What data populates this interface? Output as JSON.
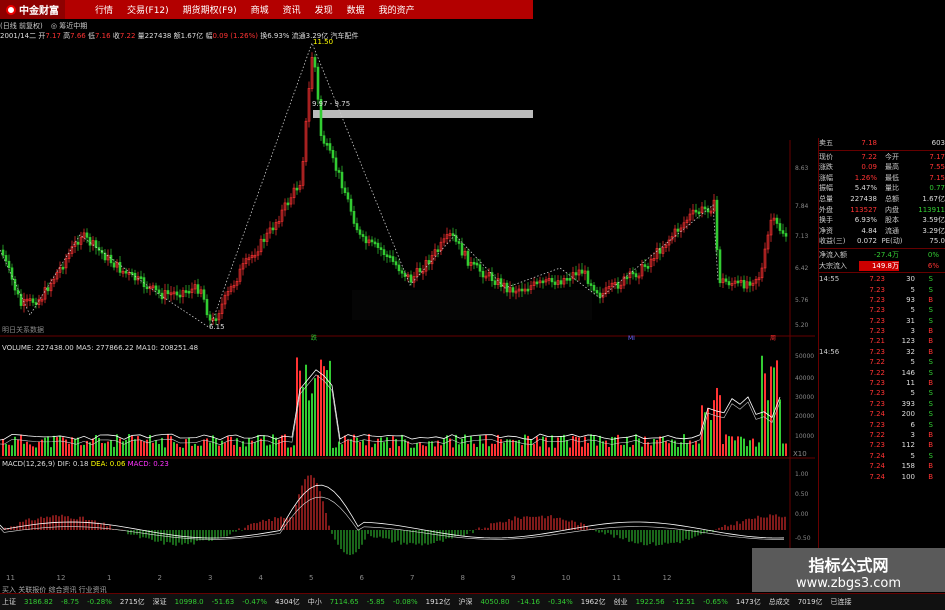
{
  "app": {
    "brand": "中金财富",
    "menu": [
      "行情",
      "交易(F12)",
      "期货期权(F9)",
      "商城",
      "资讯",
      "发现",
      "数据",
      "我的资产"
    ]
  },
  "info": {
    "stock": "2001/14二",
    "tabs": "(日线 前复权)",
    "buttons": "◎ 筹近中期"
  },
  "quote": {
    "open_label": "开",
    "open": "7.17",
    "high_label": "高",
    "high": "7.66",
    "low_label": "低",
    "low": "7.16",
    "close_label": "收",
    "close": "7.22",
    "vol_label": "量",
    "vol": "227438",
    "amt_label": "额",
    "amt": "1.67亿",
    "chg_label": "幅",
    "chg": "0.09 (1.26%)",
    "turn_label": "换",
    "turn": "6.93%",
    "float_label": "流通",
    "float": "3.29亿",
    "sector": "汽车配件"
  },
  "price_chart": {
    "high_label": "11.50",
    "low_label": "6.15",
    "band_label": "9.97 - 9.75",
    "axis_ticks": [
      "8.63",
      "7.84",
      "7.13",
      "6.42",
      "5.76",
      "5.20"
    ],
    "markers": [
      "跌",
      "MI",
      "周"
    ],
    "footnote": "明日关系数据"
  },
  "volume": {
    "header": "VOLUME: 227438.00  MA5: 277866.22  MA10: 208251.48",
    "axis_ticks": [
      "50000",
      "40000",
      "30000",
      "20000",
      "10000"
    ],
    "unit": "X10"
  },
  "macd": {
    "name": "MACD(12,26,9)",
    "dif": "DIF: 0.18",
    "dea": "DEA: 0.06",
    "macd": "MACD: 0.23",
    "axis_ticks": [
      "1.00",
      "0.50",
      "0.00",
      "-0.50"
    ]
  },
  "x_labels": [
    "11",
    "12",
    "1",
    "2",
    "3",
    "4",
    "5",
    "6",
    "7",
    "8",
    "9",
    "10",
    "11",
    "12"
  ],
  "right_panel": {
    "sell5": {
      "label": "卖五",
      "price": "7.18",
      "vol": "603"
    },
    "stats": [
      {
        "l1": "现价",
        "v1": "7.22",
        "l2": "今开",
        "v2": "7.17",
        "c1": "up",
        "c2": "up"
      },
      {
        "l1": "涨跌",
        "v1": "0.09",
        "l2": "最高",
        "v2": "7.55",
        "c1": "up",
        "c2": "up"
      },
      {
        "l1": "涨幅",
        "v1": "1.26%",
        "l2": "最低",
        "v2": "7.15",
        "c1": "up",
        "c2": "up"
      },
      {
        "l1": "振幅",
        "v1": "5.47%",
        "l2": "量比",
        "v2": "0.77",
        "c1": "wht",
        "c2": "down"
      },
      {
        "l1": "总量",
        "v1": "227438",
        "l2": "总额",
        "v2": "1.67亿",
        "c1": "wht",
        "c2": "wht"
      },
      {
        "l1": "外盘",
        "v1": "113527",
        "l2": "内盘",
        "v2": "113911",
        "c1": "up",
        "c2": "down"
      },
      {
        "l1": "换手",
        "v1": "6.93%",
        "l2": "股本",
        "v2": "3.59亿",
        "c1": "wht",
        "c2": "wht"
      },
      {
        "l1": "净资",
        "v1": "4.84",
        "l2": "流通",
        "v2": "3.29亿",
        "c1": "wht",
        "c2": "wht"
      },
      {
        "l1": "收益(三)",
        "v1": "0.072",
        "l2": "PE(动)",
        "v2": "75.0",
        "c1": "wht",
        "c2": "wht"
      }
    ],
    "flow": [
      {
        "label": "净流入额",
        "value": "-27.4万",
        "pct": "0%"
      },
      {
        "label": "大宗流入",
        "value": "149.8万",
        "pct": "6%"
      }
    ],
    "ticks_a": {
      "time": "14:55",
      "rows": [
        {
          "p": "7.23",
          "q": "30",
          "s": "S"
        },
        {
          "p": "7.23",
          "q": "5",
          "s": "S"
        },
        {
          "p": "7.23",
          "q": "93",
          "s": "B"
        },
        {
          "p": "7.23",
          "q": "5",
          "s": "S"
        },
        {
          "p": "7.23",
          "q": "31",
          "s": "S"
        },
        {
          "p": "7.23",
          "q": "3",
          "s": "B"
        },
        {
          "p": "7.21",
          "q": "123",
          "s": "B"
        }
      ]
    },
    "ticks_b": {
      "time": "14:56",
      "rows": [
        {
          "p": "7.23",
          "q": "32",
          "s": "B"
        },
        {
          "p": "7.22",
          "q": "5",
          "s": "S"
        },
        {
          "p": "7.22",
          "q": "146",
          "s": "S"
        },
        {
          "p": "7.23",
          "q": "11",
          "s": "B"
        },
        {
          "p": "7.23",
          "q": "5",
          "s": "S"
        },
        {
          "p": "7.23",
          "q": "393",
          "s": "S"
        },
        {
          "p": "7.24",
          "q": "200",
          "s": "S"
        },
        {
          "p": "7.23",
          "q": "6",
          "s": "S"
        },
        {
          "p": "7.22",
          "q": "3",
          "s": "B"
        },
        {
          "p": "7.23",
          "q": "112",
          "s": "B"
        },
        {
          "p": "7.24",
          "q": "5",
          "s": "S"
        },
        {
          "p": "7.24",
          "q": "158",
          "s": "B"
        },
        {
          "p": "7.24",
          "q": "100",
          "s": "B"
        }
      ]
    }
  },
  "status": {
    "items": [
      {
        "text": "上证",
        "c": "wht"
      },
      {
        "text": "3186.82",
        "c": "down"
      },
      {
        "text": "-8.75",
        "c": "down"
      },
      {
        "text": "-0.28%",
        "c": "down"
      },
      {
        "text": "2715亿",
        "c": "wht"
      },
      {
        "text": "深证",
        "c": "wht"
      },
      {
        "text": "10998.0",
        "c": "down"
      },
      {
        "text": "-51.63",
        "c": "down"
      },
      {
        "text": "-0.47%",
        "c": "down"
      },
      {
        "text": "4304亿",
        "c": "wht"
      },
      {
        "text": "中小",
        "c": "wht"
      },
      {
        "text": "7114.65",
        "c": "down"
      },
      {
        "text": "-5.85",
        "c": "down"
      },
      {
        "text": "-0.08%",
        "c": "down"
      },
      {
        "text": "1912亿",
        "c": "wht"
      },
      {
        "text": "沪深",
        "c": "wht"
      },
      {
        "text": "4050.80",
        "c": "down"
      },
      {
        "text": "-14.16",
        "c": "down"
      },
      {
        "text": "-0.34%",
        "c": "down"
      },
      {
        "text": "1962亿",
        "c": "wht"
      },
      {
        "text": "创业",
        "c": "wht"
      },
      {
        "text": "1922.56",
        "c": "down"
      },
      {
        "text": "-12.51",
        "c": "down"
      },
      {
        "text": "-0.65%",
        "c": "down"
      },
      {
        "text": "1473亿",
        "c": "wht"
      },
      {
        "text": "总成交",
        "c": "wht"
      },
      {
        "text": "7019亿",
        "c": "wht"
      },
      {
        "text": "已连接",
        "c": "wht"
      }
    ]
  },
  "bottom_tabs": "买入 关联报价 综合资讯 行业资讯",
  "watermark": {
    "line1": "指标公式网",
    "line2": "www.zbgs3.com"
  }
}
